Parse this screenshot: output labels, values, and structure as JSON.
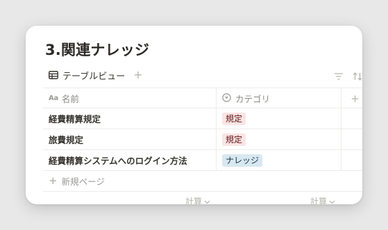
{
  "page_title": "3.関連ナレッジ",
  "view": {
    "tab_label": "テーブルビュー",
    "add_view": "+"
  },
  "columns": [
    {
      "icon": "text-property-icon",
      "icon_text": "Aa",
      "label": "名前"
    },
    {
      "icon": "select-property-icon",
      "label": "カテゴリ"
    }
  ],
  "add_column": "+",
  "rows": [
    {
      "name": "経費精算規定",
      "category": "規定",
      "tag_bg": "#fbe4e4",
      "tag_color": "#5d1715"
    },
    {
      "name": "旅費規定",
      "category": "規定",
      "tag_bg": "#fbe4e4",
      "tag_color": "#5d1715"
    },
    {
      "name": "経費精算システムへのログイン方法",
      "category": "ナレッジ",
      "tag_bg": "#d8e8f1",
      "tag_color": "#183347"
    }
  ],
  "new_row": {
    "icon": "+",
    "label": "新規ページ"
  },
  "footer": {
    "calc_1": "計算",
    "calc_2": "計算"
  },
  "colors": {
    "background": "#e8e8e8",
    "card": "#ffffff",
    "text": "#37352f",
    "muted": "#9b9a97",
    "border": "#ececea"
  }
}
